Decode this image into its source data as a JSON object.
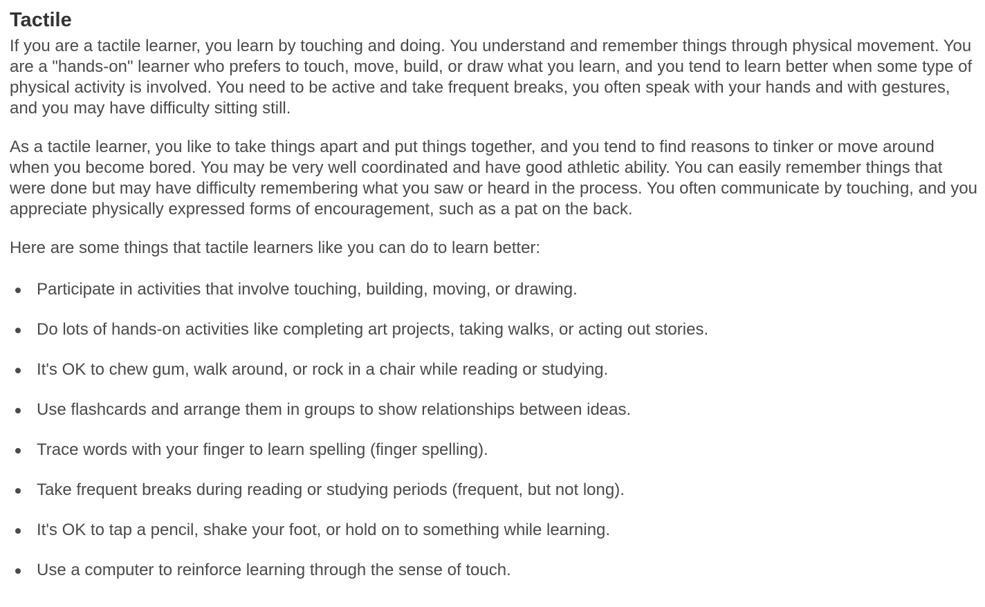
{
  "title": "Tactile",
  "paragraphs": [
    "If you are a tactile learner, you learn by touching and doing. You understand and remember things through physical movement. You are a \"hands-on\" learner who prefers to touch, move, build, or draw what you learn, and you tend to learn better when some type of physical activity is involved. You need to be active and take frequent breaks, you often speak with your hands and with gestures, and you may have difficulty sitting still.",
    "As a tactile learner, you like to take things apart and put things together, and you tend to find reasons to tinker or move around when you become bored. You may be very well coordinated and have good athletic ability. You can easily remember things that were done but may have difficulty remembering what you saw or heard in the process. You often communicate by touching, and you appreciate physically expressed forms of encouragement, such as a pat on the back."
  ],
  "intro": "Here are some things that tactile learners like you can do to learn better:",
  "tips": [
    "Participate in activities that involve touching, building, moving, or drawing.",
    "Do lots of hands-on activities like completing art projects, taking walks, or acting out stories.",
    "It's OK to chew gum, walk around, or rock in a chair while reading or studying.",
    "Use flashcards and arrange them in groups to show relationships between ideas.",
    "Trace words with your finger to learn spelling (finger spelling).",
    "Take frequent breaks during reading or studying periods (frequent, but not long).",
    "It's OK to tap a pencil, shake your foot, or hold on to something while learning.",
    "Use a computer to reinforce learning through the sense of touch."
  ]
}
